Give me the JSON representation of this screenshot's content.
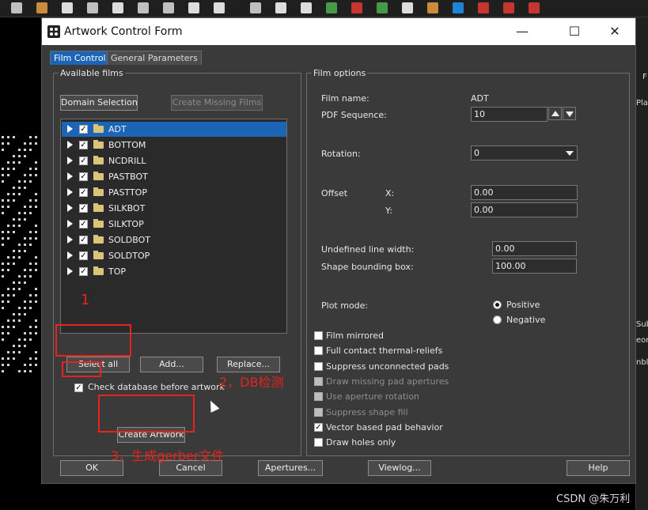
{
  "dialog": {
    "title": "Artwork Control Form",
    "window_controls": {
      "minimize": "—",
      "maximize": "☐",
      "close": "✕"
    }
  },
  "tabs": [
    {
      "label": "Film Control",
      "active": true
    },
    {
      "label": "General Parameters",
      "active": false
    }
  ],
  "available_films": {
    "group_title": "Available films",
    "domain_selection_label": "Domain Selection",
    "create_missing_label": "Create Missing Films",
    "films": [
      {
        "name": "ADT",
        "checked": true,
        "selected": true
      },
      {
        "name": "BOTTOM",
        "checked": true
      },
      {
        "name": "NCDRILL",
        "checked": true
      },
      {
        "name": "PASTBOT",
        "checked": true
      },
      {
        "name": "PASTTOP",
        "checked": true
      },
      {
        "name": "SILKBOT",
        "checked": true
      },
      {
        "name": "SILKTOP",
        "checked": true
      },
      {
        "name": "SOLDBOT",
        "checked": true
      },
      {
        "name": "SOLDTOP",
        "checked": true
      },
      {
        "name": "TOP",
        "checked": true
      }
    ],
    "select_all_label": "Select all",
    "add_label": "Add...",
    "replace_label": "Replace...",
    "check_db_label": "Check database before artwork",
    "check_db_checked": true,
    "create_artwork_label": "Create Artwork"
  },
  "film_options": {
    "group_title": "Film options",
    "film_name_label": "Film name:",
    "film_name_value": "ADT",
    "pdf_sequence_label": "PDF Sequence:",
    "pdf_sequence_value": "10",
    "rotation_label": "Rotation:",
    "rotation_value": "0",
    "offset_label": "Offset",
    "offset_x_label": "X:",
    "offset_x_value": "0.00",
    "offset_y_label": "Y:",
    "offset_y_value": "0.00",
    "undefined_line_width_label": "Undefined line width:",
    "undefined_line_width_value": "0.00",
    "shape_bounding_box_label": "Shape bounding box:",
    "shape_bounding_box_value": "100.00",
    "plot_mode_label": "Plot mode:",
    "plot_mode_positive": "Positive",
    "plot_mode_negative": "Negative",
    "options": [
      {
        "label": "Film mirrored",
        "checked": false,
        "enabled": true
      },
      {
        "label": "Full contact thermal-reliefs",
        "checked": false,
        "enabled": true
      },
      {
        "label": "Suppress unconnected pads",
        "checked": false,
        "enabled": true
      },
      {
        "label": "Draw missing pad apertures",
        "checked": false,
        "enabled": false
      },
      {
        "label": "Use aperture rotation",
        "checked": false,
        "enabled": false
      },
      {
        "label": "Suppress shape fill",
        "checked": false,
        "enabled": false
      },
      {
        "label": "Vector based pad behavior",
        "checked": true,
        "enabled": true
      },
      {
        "label": "Draw holes only",
        "checked": false,
        "enabled": true
      }
    ]
  },
  "bottom_buttons": {
    "ok": "OK",
    "cancel": "Cancel",
    "apertures": "Apertures...",
    "viewlog": "Viewlog...",
    "help": "Help"
  },
  "annotations": {
    "step1": "1",
    "step2": "2，DB检测",
    "step3": "3，生成gerber文件",
    "color": "#e8221c"
  },
  "right_panel_fragments": [
    "F",
    "Pla",
    "Sub",
    "eon",
    "nbly"
  ],
  "watermark": "CSDN @朱万利"
}
